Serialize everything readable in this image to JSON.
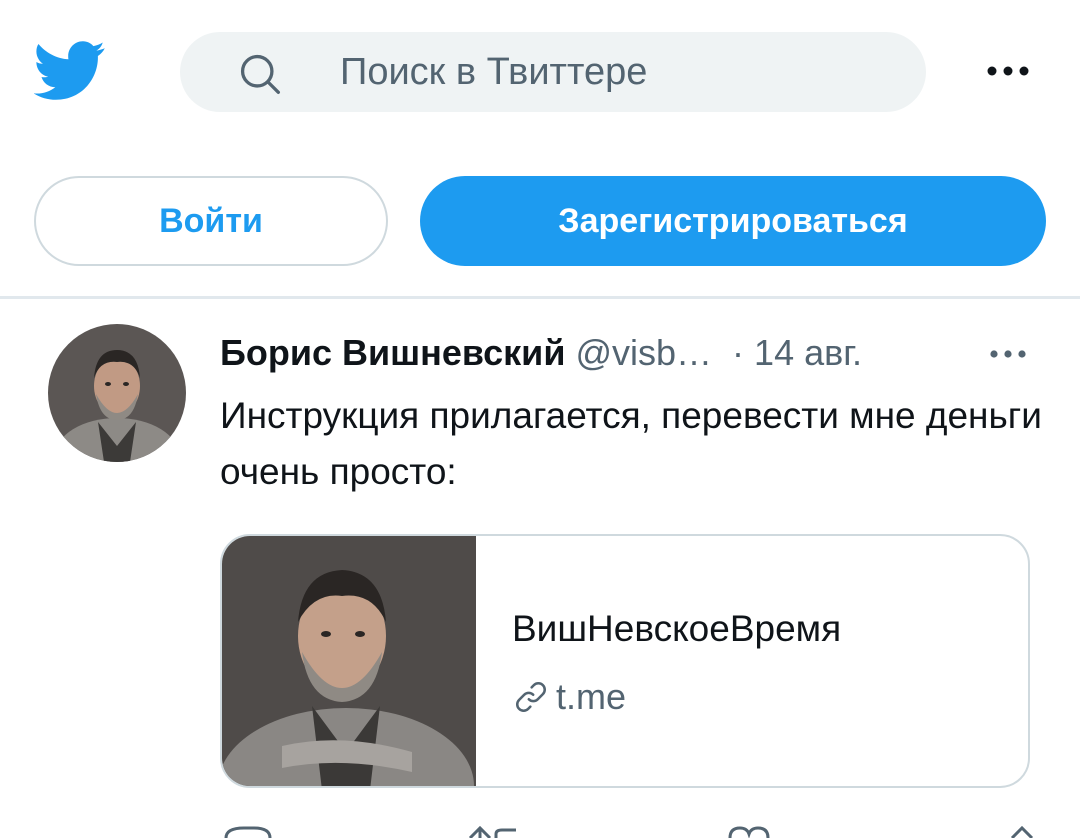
{
  "search": {
    "placeholder": "Поиск в Твиттере"
  },
  "auth": {
    "login_label": "Войти",
    "signup_label": "Зарегистрироваться"
  },
  "tweet": {
    "author_name": "Борис Вишневский",
    "handle": "@visb…",
    "separator": "·",
    "date": "14 авг.",
    "text": "Инструкция прилагается, перевести мне деньги очень просто:",
    "card": {
      "title": "ВишНевскоеВремя",
      "domain": "t.me"
    }
  },
  "colors": {
    "brand": "#1d9bf0",
    "text": "#0f1419",
    "secondary": "#536471",
    "border": "#cfd9de",
    "search_bg": "#eff3f4"
  },
  "icons": [
    "twitter-bird-icon",
    "search-icon",
    "more-icon",
    "link-icon",
    "reply-icon",
    "retweet-icon",
    "like-icon",
    "share-icon"
  ]
}
